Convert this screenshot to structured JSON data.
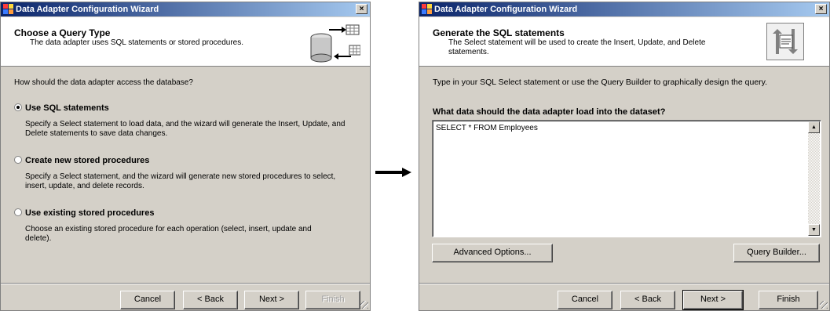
{
  "wizard1": {
    "title": "Data Adapter Configuration Wizard",
    "close_glyph": "×",
    "header_title": "Choose a Query Type",
    "header_subtitle": "The data adapter uses SQL statements or stored procedures.",
    "prompt": "How should the data adapter access the database?",
    "options": [
      {
        "label": "Use SQL statements",
        "selected": true,
        "description": "Specify a Select statement to load data, and the wizard will generate the Insert, Update, and Delete statements to save data changes."
      },
      {
        "label": "Create new stored procedures",
        "selected": false,
        "description": "Specify a Select statement, and the wizard will generate new stored procedures to select, insert, update, and delete records."
      },
      {
        "label": "Use existing stored procedures",
        "selected": false,
        "description": "Choose an existing stored procedure for each operation (select, insert, update and delete)."
      }
    ],
    "buttons": {
      "cancel": "Cancel",
      "back": "< Back",
      "next": "Next >",
      "finish": "Finish"
    }
  },
  "wizard2": {
    "title": "Data Adapter Configuration Wizard",
    "close_glyph": "×",
    "header_title": "Generate the SQL statements",
    "header_subtitle": "The Select statement will be used to create the Insert, Update, and Delete statements.",
    "instructions": "Type in your SQL Select statement or use the Query Builder to graphically design the query.",
    "question": "What data should the data adapter load into the dataset?",
    "sql_text": "SELECT * FROM Employees",
    "advanced_button": "Advanced Options...",
    "query_builder_button": "Query Builder...",
    "buttons": {
      "cancel": "Cancel",
      "back": "< Back",
      "next": "Next >",
      "finish": "Finish"
    }
  },
  "colors": {
    "titlebar_start": "#0a246a",
    "titlebar_end": "#a6caf0",
    "dialog_face": "#d4d0c8"
  },
  "icons": {
    "app": "app-icon",
    "header_image_1": "database-table-icon",
    "header_image_2": "document-arrows-icon",
    "transition": "right-arrow-icon"
  }
}
